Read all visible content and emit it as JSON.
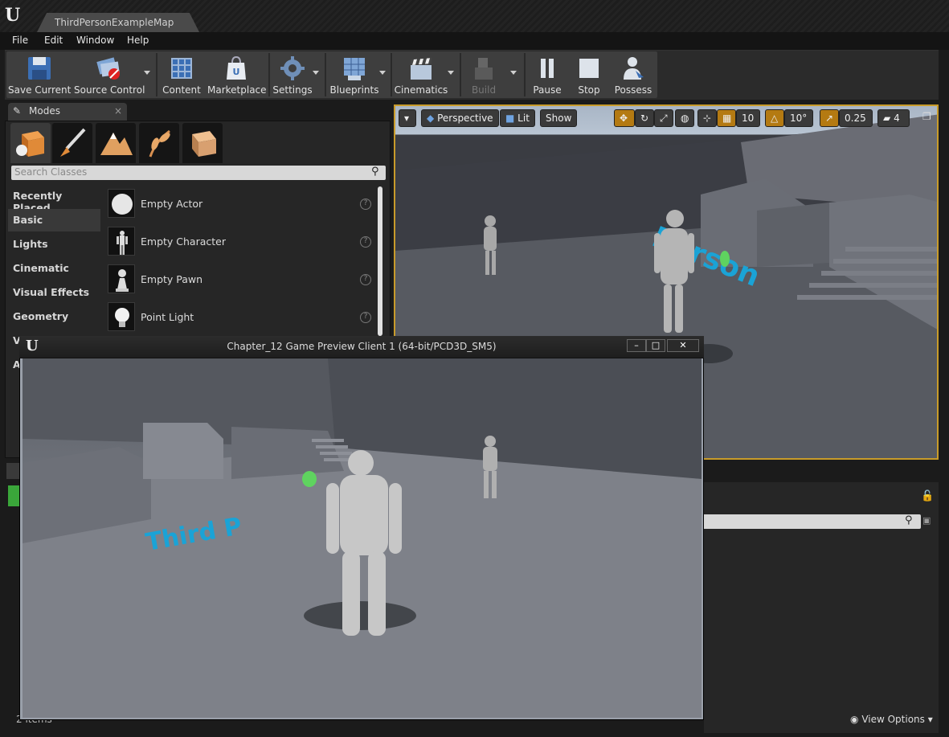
{
  "window": {
    "tab_title": "ThirdPersonExampleMap"
  },
  "menu": [
    "File",
    "Edit",
    "Window",
    "Help"
  ],
  "toolbar": {
    "save_current": "Save Current",
    "source_control": "Source Control",
    "content": "Content",
    "marketplace": "Marketplace",
    "settings": "Settings",
    "blueprints": "Blueprints",
    "cinematics": "Cinematics",
    "build": "Build",
    "pause": "Pause",
    "stop": "Stop",
    "possess": "Possess"
  },
  "modes": {
    "tab_label": "Modes",
    "search_placeholder": "Search Classes",
    "categories": [
      "Recently Placed",
      "Basic",
      "Lights",
      "Cinematic",
      "Visual Effects",
      "Geometry",
      "V",
      "A"
    ],
    "active_category": "Basic",
    "items": [
      {
        "name": "Empty Actor",
        "icon": "sphere-icon"
      },
      {
        "name": "Empty Character",
        "icon": "mannequin-icon"
      },
      {
        "name": "Empty Pawn",
        "icon": "pawn-icon"
      },
      {
        "name": "Point Light",
        "icon": "lightbulb-icon"
      }
    ]
  },
  "viewport": {
    "perspective": "Perspective",
    "lit": "Lit",
    "show": "Show",
    "grid_snap": "10",
    "rotation_snap": "10°",
    "scale_snap": "0.25",
    "camera_speed": "4",
    "floor_text": "Person"
  },
  "content_browser": {
    "items_count": "2 items",
    "view_options": "View Options"
  },
  "preview_window": {
    "title": "Chapter_12 Game Preview Client 1 (64-bit/PCD3D_SM5)",
    "floor_text": "Third P"
  },
  "colors": {
    "accent": "#c89b2a",
    "floor_text": "#1aa3d6",
    "pickup": "#5fd35f"
  }
}
